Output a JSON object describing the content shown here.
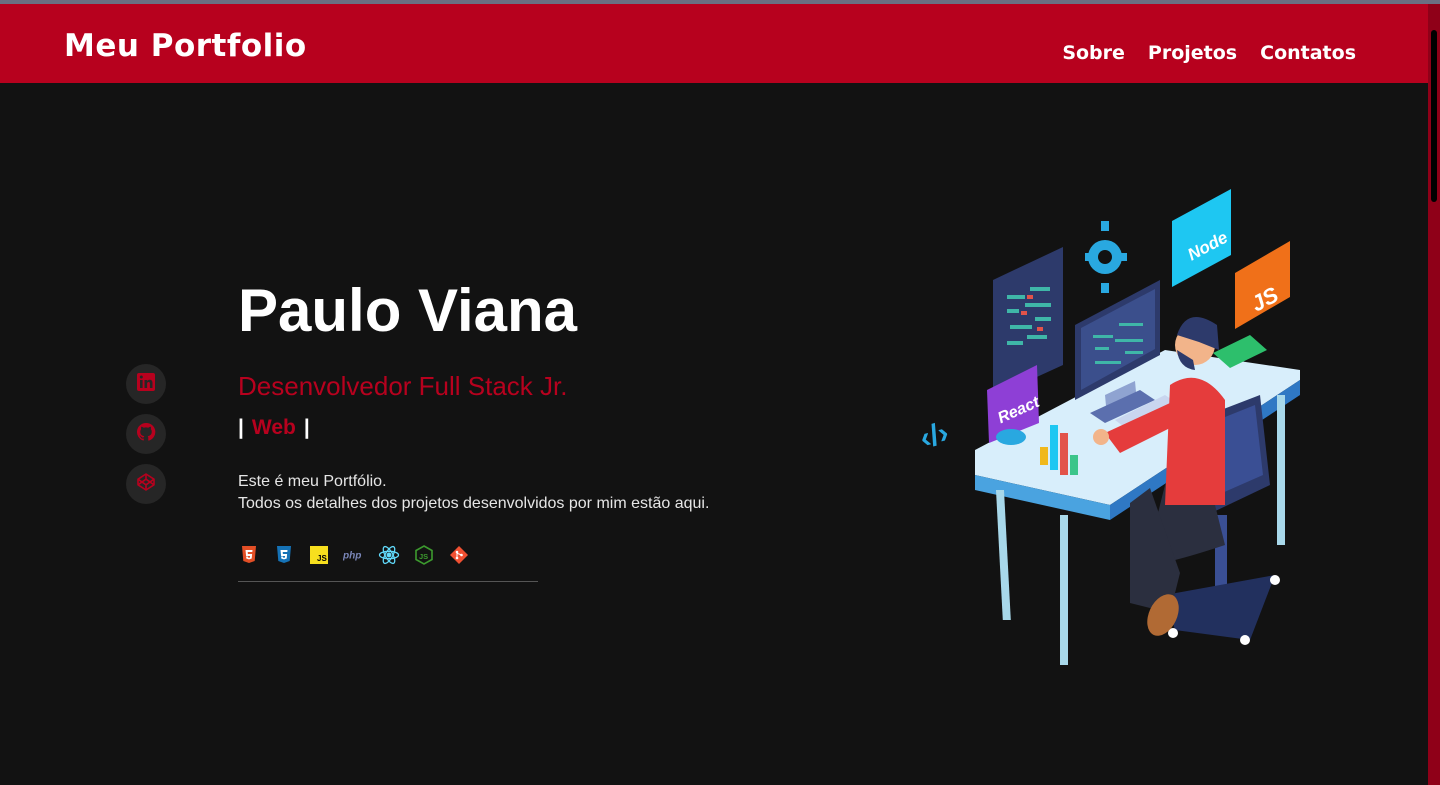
{
  "header": {
    "logo": "Meu Portfolio",
    "nav": [
      "Sobre",
      "Projetos",
      "Contatos"
    ]
  },
  "socials": [
    {
      "icon": "linkedin-icon"
    },
    {
      "icon": "github-icon"
    },
    {
      "icon": "codepen-icon"
    }
  ],
  "hero": {
    "name": "Paulo Viana",
    "role": "Desenvolvedor Full Stack Jr.",
    "typing_bar": "|",
    "typing_word": "Web",
    "intro_line1": "Este é meu Portfólio.",
    "intro_line2": "Todos os detalhes dos projetos desenvolvidos por mim estão aqui."
  },
  "tech_icons": [
    "html5-icon",
    "css3-icon",
    "javascript-icon",
    "php-icon",
    "react-icon",
    "nodejs-icon",
    "git-icon"
  ],
  "illustration": {
    "labels": [
      "Node",
      "JS",
      "React"
    ]
  },
  "colors": {
    "accent": "#b7011e",
    "background": "#121212",
    "header": "#b7011e"
  }
}
